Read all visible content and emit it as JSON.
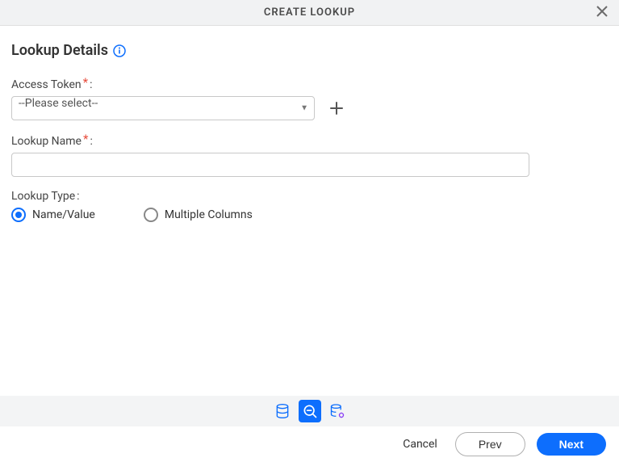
{
  "header": {
    "title": "CREATE LOOKUP"
  },
  "section": {
    "title": "Lookup Details"
  },
  "fields": {
    "accessToken": {
      "label": "Access Token",
      "required": "*",
      "colon": ":",
      "selected": "--Please select--"
    },
    "lookupName": {
      "label": "Lookup Name",
      "required": "*",
      "colon": ":",
      "value": ""
    },
    "lookupType": {
      "label": "Lookup Type",
      "colon": ":",
      "options": {
        "nameValue": "Name/Value",
        "multipleColumns": "Multiple Columns"
      },
      "selected": "nameValue"
    }
  },
  "footer": {
    "cancel": "Cancel",
    "prev": "Prev",
    "next": "Next"
  }
}
